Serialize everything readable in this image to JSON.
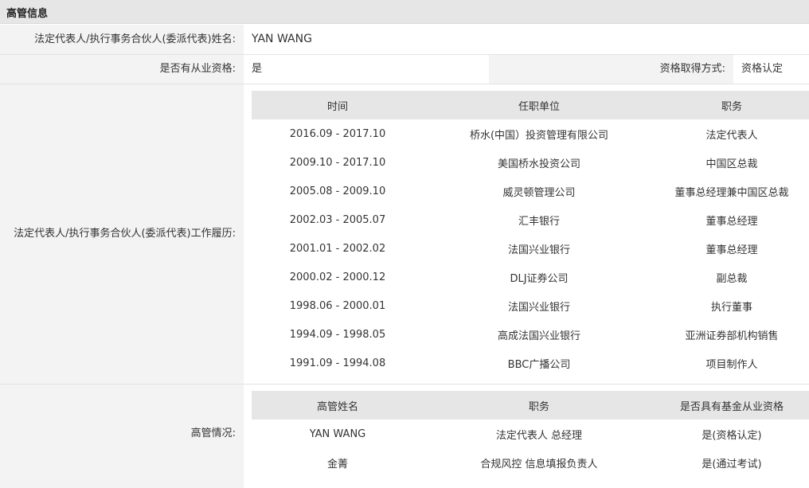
{
  "section_title": "高管信息",
  "rep_name": {
    "label": "法定代表人/执行事务合伙人(委派代表)姓名:",
    "value": "YAN WANG"
  },
  "qualification": {
    "label": "是否有从业资格:",
    "value": "是",
    "method_label": "资格取得方式:",
    "method_value": "资格认定"
  },
  "work_history": {
    "label": "法定代表人/执行事务合伙人(委派代表)工作履历:",
    "headers": [
      "时间",
      "任职单位",
      "职务"
    ],
    "rows": [
      [
        "2016.09 - 2017.10",
        "桥水(中国）投资管理有限公司",
        "法定代表人"
      ],
      [
        "2009.10 - 2017.10",
        "美国桥水投资公司",
        "中国区总裁"
      ],
      [
        "2005.08 - 2009.10",
        "威灵顿管理公司",
        "董事总经理兼中国区总裁"
      ],
      [
        "2002.03 - 2005.07",
        "汇丰银行",
        "董事总经理"
      ],
      [
        "2001.01 - 2002.02",
        "法国兴业银行",
        "董事总经理"
      ],
      [
        "2000.02 - 2000.12",
        "DLJ证券公司",
        "副总裁"
      ],
      [
        "1998.06 - 2000.01",
        "法国兴业银行",
        "执行董事"
      ],
      [
        "1994.09 - 1998.05",
        "高成法国兴业银行",
        "亚洲证券部机构销售"
      ],
      [
        "1991.09 - 1994.08",
        "BBC广播公司",
        "项目制作人"
      ]
    ]
  },
  "executives": {
    "label": "高管情况:",
    "headers": [
      "高管姓名",
      "职务",
      "是否具有基金从业资格"
    ],
    "rows": [
      [
        "YAN WANG",
        "法定代表人 总经理",
        "是(资格认定)"
      ],
      [
        "金菁",
        "合规风控 信息填报负责人",
        "是(通过考试)"
      ]
    ]
  }
}
